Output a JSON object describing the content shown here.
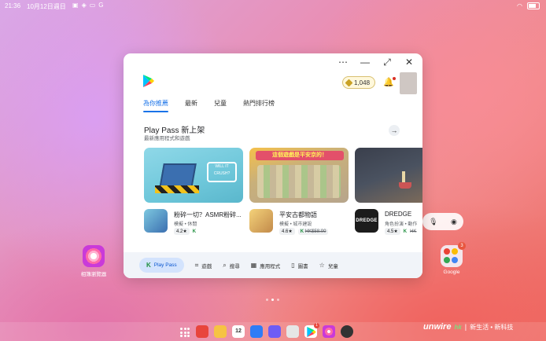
{
  "status": {
    "time": "21:36",
    "date": "10月12日週日",
    "battery_icon": "battery-icon"
  },
  "window": {
    "controls": [
      "⋯",
      "—",
      "⤢",
      "✕"
    ]
  },
  "header": {
    "points": "1,048"
  },
  "tabs": [
    {
      "label": "為你推薦",
      "active": true
    },
    {
      "label": "最新"
    },
    {
      "label": "兒童"
    },
    {
      "label": "熱門排行榜"
    }
  ],
  "section": {
    "title": "Play Pass 新上架",
    "subtitle": "最新應用程式和遊戲"
  },
  "cards": [
    {
      "banner_logo": "WILL IT CRUSH?",
      "name": "粉碎一切？ASMR粉碎...",
      "category": "模擬 • 休閒",
      "rating": "4.2★"
    },
    {
      "banner_title": "這個遊戲是平安京的！",
      "name": "平安古都物語",
      "category": "模擬 • 城市建設",
      "rating": "4.6★",
      "price": "HK$58.00"
    },
    {
      "icon_text": "DREDGE",
      "name": "DREDGE",
      "category": "角色扮演 • 動作",
      "rating": "4.5★",
      "price": "HK"
    }
  ],
  "bottom_nav": [
    {
      "label": "Play Pass",
      "icon": "play-pass-icon",
      "active": true
    },
    {
      "label": "遊戲",
      "icon": "gamepad-icon"
    },
    {
      "label": "搜尋",
      "icon": "search-icon"
    },
    {
      "label": "應用程式",
      "icon": "apps-icon"
    },
    {
      "label": "圖書",
      "icon": "book-icon"
    },
    {
      "label": "兒童",
      "icon": "star-icon"
    }
  ],
  "desktop": {
    "gallery_label": "相簿瀏覽器",
    "google_label": "Google",
    "google_badge": "3"
  },
  "dock": {
    "calendar_day": "12",
    "play_badge": "1"
  },
  "watermark": {
    "brand": "unwire",
    "sub": "hk",
    "tag": "新生活 • 新科技"
  }
}
